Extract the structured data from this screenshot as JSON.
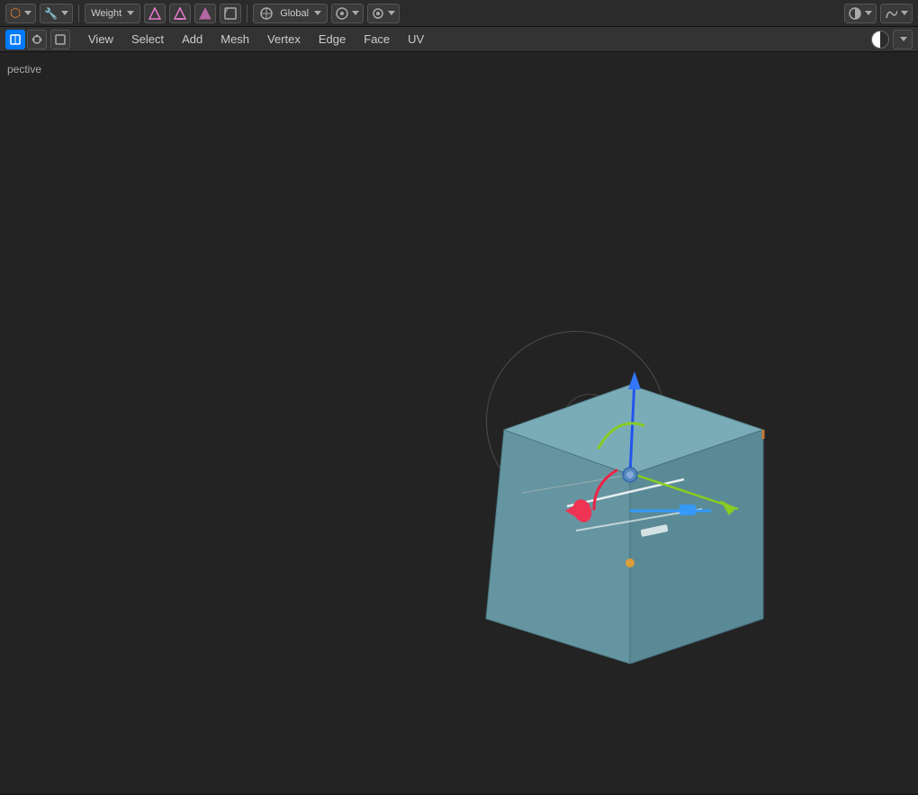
{
  "toolbar": {
    "mode_label": "Weight",
    "transform_label": "Global",
    "chevron": "▾"
  },
  "menubar": {
    "view": "View",
    "select": "Select",
    "add": "Add",
    "mesh": "Mesh",
    "vertex": "Vertex",
    "edge": "Edge",
    "face": "Face",
    "uv": "UV"
  },
  "viewport": {
    "perspective_label": "pective"
  },
  "icons": {
    "blender": "⬡",
    "tool": "🔧",
    "weight_text": "W"
  }
}
